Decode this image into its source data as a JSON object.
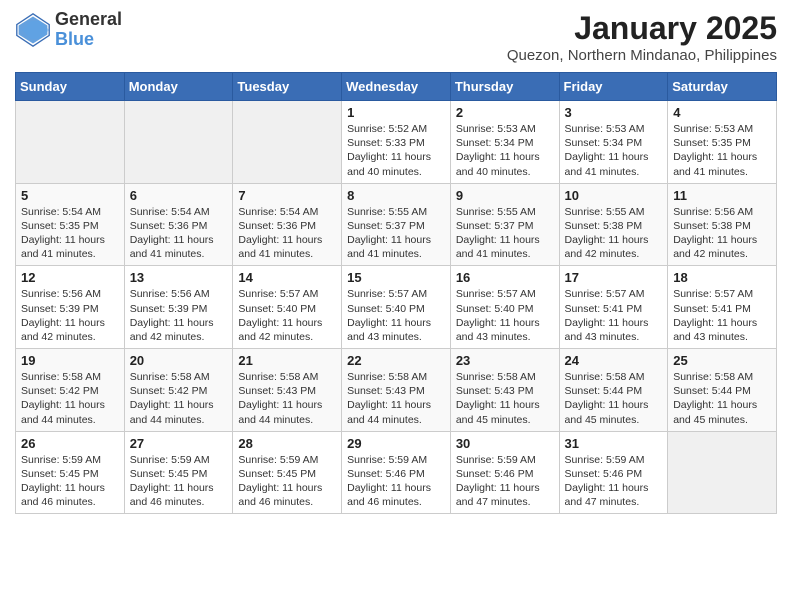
{
  "logo": {
    "general": "General",
    "blue": "Blue"
  },
  "title": "January 2025",
  "subtitle": "Quezon, Northern Mindanao, Philippines",
  "days_of_week": [
    "Sunday",
    "Monday",
    "Tuesday",
    "Wednesday",
    "Thursday",
    "Friday",
    "Saturday"
  ],
  "weeks": [
    [
      {
        "day": "",
        "info": ""
      },
      {
        "day": "",
        "info": ""
      },
      {
        "day": "",
        "info": ""
      },
      {
        "day": "1",
        "info": "Sunrise: 5:52 AM\nSunset: 5:33 PM\nDaylight: 11 hours and 40 minutes."
      },
      {
        "day": "2",
        "info": "Sunrise: 5:53 AM\nSunset: 5:34 PM\nDaylight: 11 hours and 40 minutes."
      },
      {
        "day": "3",
        "info": "Sunrise: 5:53 AM\nSunset: 5:34 PM\nDaylight: 11 hours and 41 minutes."
      },
      {
        "day": "4",
        "info": "Sunrise: 5:53 AM\nSunset: 5:35 PM\nDaylight: 11 hours and 41 minutes."
      }
    ],
    [
      {
        "day": "5",
        "info": "Sunrise: 5:54 AM\nSunset: 5:35 PM\nDaylight: 11 hours and 41 minutes."
      },
      {
        "day": "6",
        "info": "Sunrise: 5:54 AM\nSunset: 5:36 PM\nDaylight: 11 hours and 41 minutes."
      },
      {
        "day": "7",
        "info": "Sunrise: 5:54 AM\nSunset: 5:36 PM\nDaylight: 11 hours and 41 minutes."
      },
      {
        "day": "8",
        "info": "Sunrise: 5:55 AM\nSunset: 5:37 PM\nDaylight: 11 hours and 41 minutes."
      },
      {
        "day": "9",
        "info": "Sunrise: 5:55 AM\nSunset: 5:37 PM\nDaylight: 11 hours and 41 minutes."
      },
      {
        "day": "10",
        "info": "Sunrise: 5:55 AM\nSunset: 5:38 PM\nDaylight: 11 hours and 42 minutes."
      },
      {
        "day": "11",
        "info": "Sunrise: 5:56 AM\nSunset: 5:38 PM\nDaylight: 11 hours and 42 minutes."
      }
    ],
    [
      {
        "day": "12",
        "info": "Sunrise: 5:56 AM\nSunset: 5:39 PM\nDaylight: 11 hours and 42 minutes."
      },
      {
        "day": "13",
        "info": "Sunrise: 5:56 AM\nSunset: 5:39 PM\nDaylight: 11 hours and 42 minutes."
      },
      {
        "day": "14",
        "info": "Sunrise: 5:57 AM\nSunset: 5:40 PM\nDaylight: 11 hours and 42 minutes."
      },
      {
        "day": "15",
        "info": "Sunrise: 5:57 AM\nSunset: 5:40 PM\nDaylight: 11 hours and 43 minutes."
      },
      {
        "day": "16",
        "info": "Sunrise: 5:57 AM\nSunset: 5:40 PM\nDaylight: 11 hours and 43 minutes."
      },
      {
        "day": "17",
        "info": "Sunrise: 5:57 AM\nSunset: 5:41 PM\nDaylight: 11 hours and 43 minutes."
      },
      {
        "day": "18",
        "info": "Sunrise: 5:57 AM\nSunset: 5:41 PM\nDaylight: 11 hours and 43 minutes."
      }
    ],
    [
      {
        "day": "19",
        "info": "Sunrise: 5:58 AM\nSunset: 5:42 PM\nDaylight: 11 hours and 44 minutes."
      },
      {
        "day": "20",
        "info": "Sunrise: 5:58 AM\nSunset: 5:42 PM\nDaylight: 11 hours and 44 minutes."
      },
      {
        "day": "21",
        "info": "Sunrise: 5:58 AM\nSunset: 5:43 PM\nDaylight: 11 hours and 44 minutes."
      },
      {
        "day": "22",
        "info": "Sunrise: 5:58 AM\nSunset: 5:43 PM\nDaylight: 11 hours and 44 minutes."
      },
      {
        "day": "23",
        "info": "Sunrise: 5:58 AM\nSunset: 5:43 PM\nDaylight: 11 hours and 45 minutes."
      },
      {
        "day": "24",
        "info": "Sunrise: 5:58 AM\nSunset: 5:44 PM\nDaylight: 11 hours and 45 minutes."
      },
      {
        "day": "25",
        "info": "Sunrise: 5:58 AM\nSunset: 5:44 PM\nDaylight: 11 hours and 45 minutes."
      }
    ],
    [
      {
        "day": "26",
        "info": "Sunrise: 5:59 AM\nSunset: 5:45 PM\nDaylight: 11 hours and 46 minutes."
      },
      {
        "day": "27",
        "info": "Sunrise: 5:59 AM\nSunset: 5:45 PM\nDaylight: 11 hours and 46 minutes."
      },
      {
        "day": "28",
        "info": "Sunrise: 5:59 AM\nSunset: 5:45 PM\nDaylight: 11 hours and 46 minutes."
      },
      {
        "day": "29",
        "info": "Sunrise: 5:59 AM\nSunset: 5:46 PM\nDaylight: 11 hours and 46 minutes."
      },
      {
        "day": "30",
        "info": "Sunrise: 5:59 AM\nSunset: 5:46 PM\nDaylight: 11 hours and 47 minutes."
      },
      {
        "day": "31",
        "info": "Sunrise: 5:59 AM\nSunset: 5:46 PM\nDaylight: 11 hours and 47 minutes."
      },
      {
        "day": "",
        "info": ""
      }
    ]
  ]
}
